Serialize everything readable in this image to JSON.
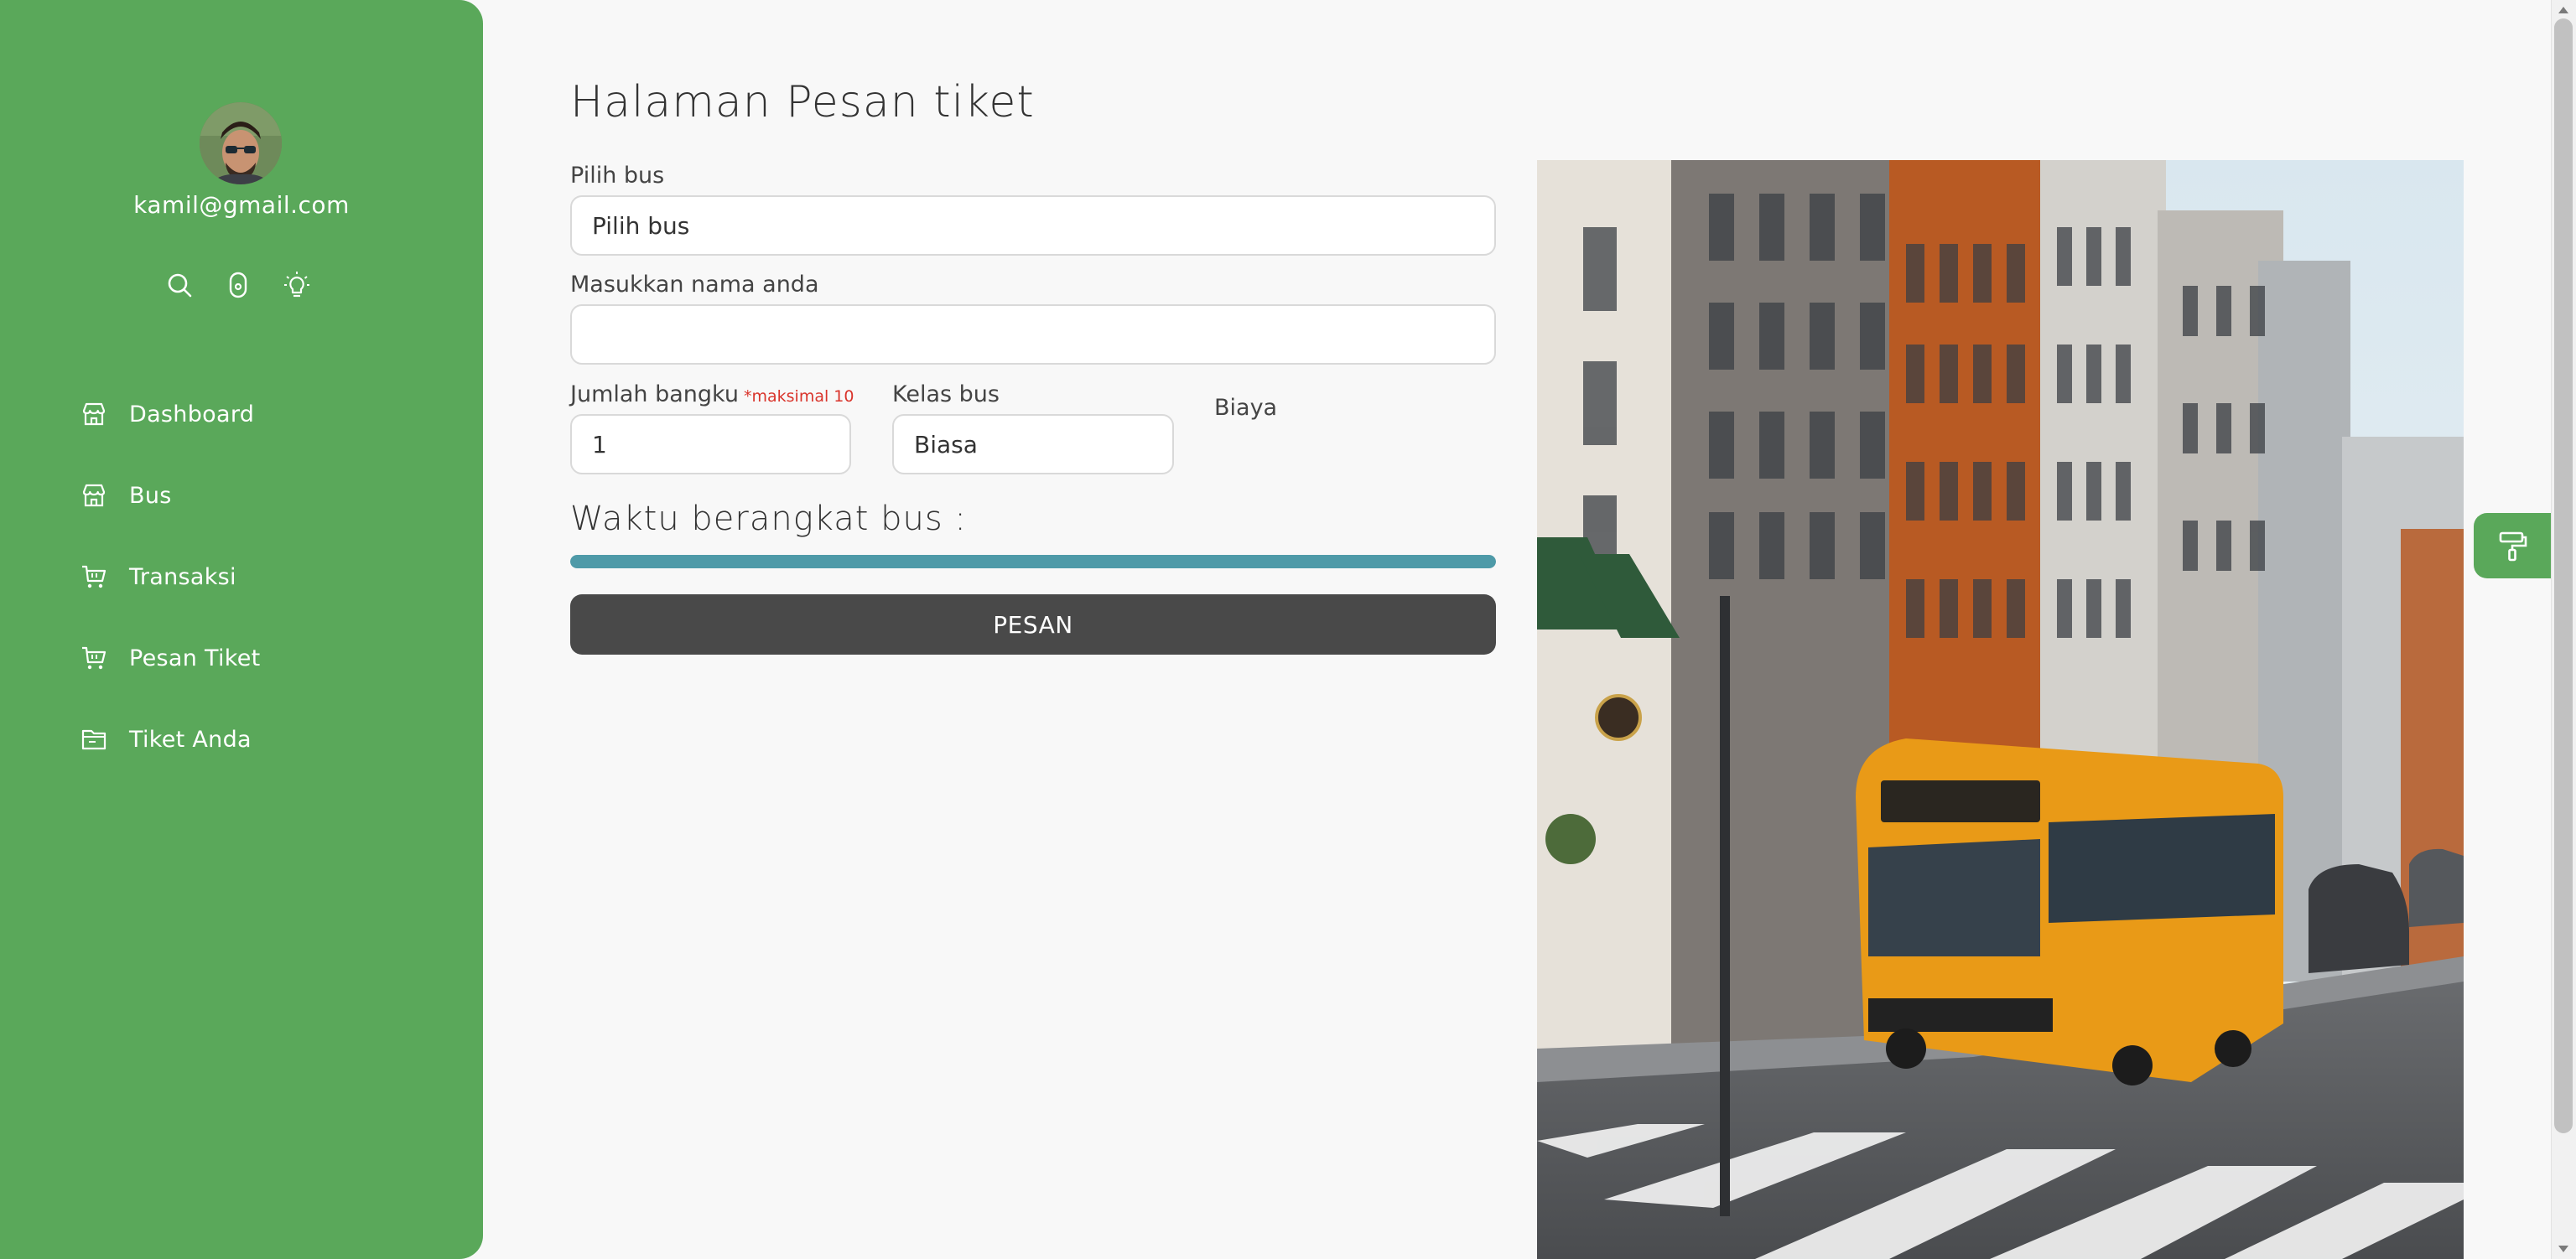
{
  "sidebar": {
    "email": "kamil@gmail.com",
    "icons": [
      "search-icon",
      "user-icon",
      "lightbulb-icon"
    ],
    "items": [
      {
        "label": "Dashboard",
        "icon": "store-icon"
      },
      {
        "label": "Bus",
        "icon": "store-icon"
      },
      {
        "label": "Transaksi",
        "icon": "cart-icon"
      },
      {
        "label": "Pesan Tiket",
        "icon": "cart-icon"
      },
      {
        "label": "Tiket Anda",
        "icon": "folder-icon"
      }
    ]
  },
  "main": {
    "title": "Halaman Pesan tiket",
    "form": {
      "bus_label": "Pilih bus",
      "bus_value": "Pilih bus",
      "name_label": "Masukkan nama anda",
      "name_value": "",
      "seats_label": "Jumlah bangku",
      "seats_note": "*maksimal 10",
      "seats_value": "1",
      "class_label": "Kelas bus",
      "class_value": "Biasa",
      "cost_label": "Biaya"
    },
    "departure_title": "Waktu berangkat bus :",
    "departure_progress_percent": 100,
    "submit_label": "PESAN"
  },
  "colors": {
    "sidebar": "#5aa85a",
    "progress": "#4e9aa8",
    "button": "#494949",
    "required": "#d9342b"
  },
  "floating_button_icon": "paint-roller-icon"
}
